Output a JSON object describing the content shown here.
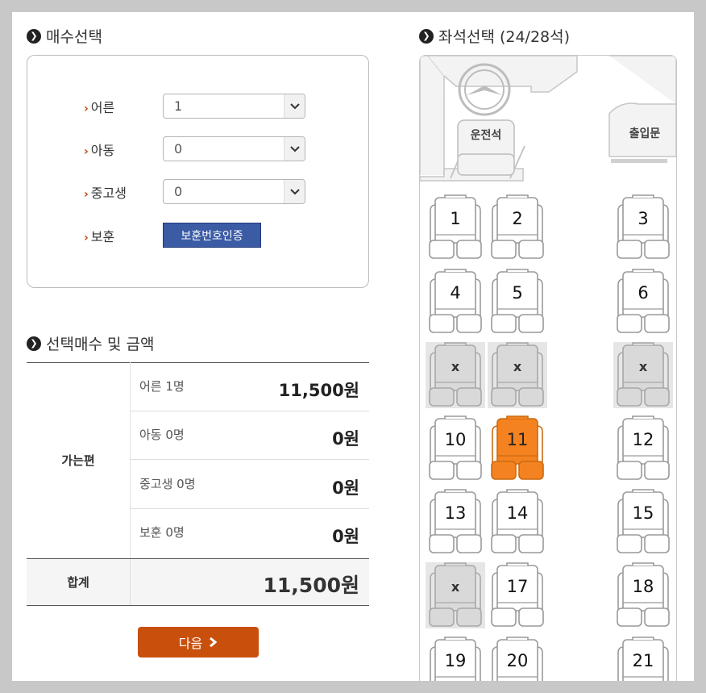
{
  "ticket_section": {
    "title": "매수선택"
  },
  "counts": [
    {
      "label": "어른",
      "value": "1"
    },
    {
      "label": "아동",
      "value": "0"
    },
    {
      "label": "중고생",
      "value": "0"
    }
  ],
  "veteran": {
    "label": "보훈",
    "button": "보훈번호인증"
  },
  "summary": {
    "title": "선택매수 및 금액",
    "group": "가는편",
    "rows": [
      {
        "label": "어른 1명",
        "amount": "11,500원"
      },
      {
        "label": "아동 0명",
        "amount": "0원"
      },
      {
        "label": "중고생 0명",
        "amount": "0원"
      },
      {
        "label": "보훈 0명",
        "amount": "0원"
      }
    ],
    "total_label": "합계",
    "total_amount": "11,500원"
  },
  "next_button": "다음",
  "seat_section": {
    "title": "좌석선택 (24/28석)"
  },
  "bus": {
    "driver": "운전석",
    "door": "출입문"
  },
  "seats": [
    {
      "label": "1",
      "status": "available"
    },
    {
      "label": "2",
      "status": "available"
    },
    {
      "label": "3",
      "status": "available"
    },
    {
      "label": "4",
      "status": "available"
    },
    {
      "label": "5",
      "status": "available"
    },
    {
      "label": "6",
      "status": "available"
    },
    {
      "label": "x",
      "status": "sold"
    },
    {
      "label": "x",
      "status": "sold"
    },
    {
      "label": "x",
      "status": "sold"
    },
    {
      "label": "10",
      "status": "available"
    },
    {
      "label": "11",
      "status": "selected"
    },
    {
      "label": "12",
      "status": "available"
    },
    {
      "label": "13",
      "status": "available"
    },
    {
      "label": "14",
      "status": "available"
    },
    {
      "label": "15",
      "status": "available"
    },
    {
      "label": "x",
      "status": "sold"
    },
    {
      "label": "17",
      "status": "available"
    },
    {
      "label": "18",
      "status": "available"
    },
    {
      "label": "19",
      "status": "available"
    },
    {
      "label": "20",
      "status": "available"
    },
    {
      "label": "21",
      "status": "available"
    }
  ],
  "colors": {
    "accent": "#c9500c",
    "selected_seat": "#f58220",
    "sold_seat": "#d9d9d9",
    "auth_button": "#3b5ba5"
  }
}
